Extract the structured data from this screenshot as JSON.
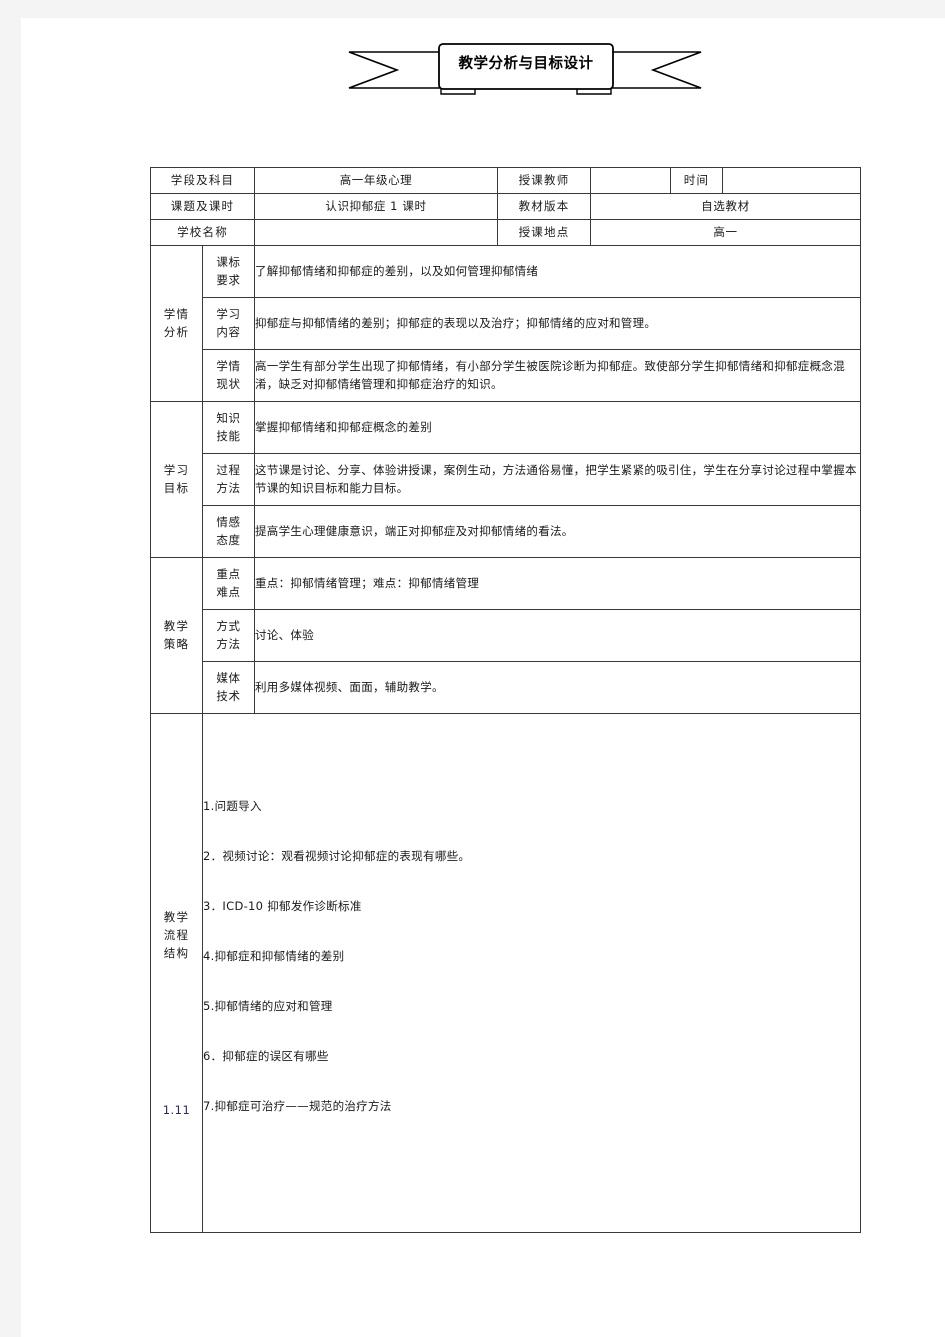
{
  "banner": {
    "title": "教学分析与目标设计"
  },
  "info_rows": [
    {
      "label": "学段及科目",
      "value": "高一年级心理",
      "label2": "授课教师",
      "value2": "",
      "label3": "时间",
      "value3": ""
    },
    {
      "label": "课题及课时",
      "value": "认识抑郁症 1 课时",
      "label2": "教材版本",
      "value2": "自选教材"
    },
    {
      "label": "学校名称",
      "value": "",
      "label2": "授课地点",
      "value2": "高一"
    }
  ],
  "sections": [
    {
      "title_lines": [
        "学情",
        "分析"
      ],
      "rows": [
        {
          "sub_lines": [
            "课标",
            "要求"
          ],
          "text": "了解抑郁情绪和抑郁症的差别，以及如何管理抑郁情绪"
        },
        {
          "sub_lines": [
            "学习",
            "内容"
          ],
          "text": "抑郁症与抑郁情绪的差别；抑郁症的表现以及治疗；抑郁情绪的应对和管理。"
        },
        {
          "sub_lines": [
            "学情",
            "现状"
          ],
          "text": "高一学生有部分学生出现了抑郁情绪，有小部分学生被医院诊断为抑郁症。致使部分学生抑郁情绪和抑郁症概念混淆，缺乏对抑郁情绪管理和抑郁症治疗的知识。"
        }
      ]
    },
    {
      "title_lines": [
        "学习",
        "目标"
      ],
      "rows": [
        {
          "sub_lines": [
            "知识",
            "技能"
          ],
          "text": "掌握抑郁情绪和抑郁症概念的差别"
        },
        {
          "sub_lines": [
            "过程",
            "方法"
          ],
          "text": "这节课是讨论、分享、体验讲授课，案例生动，方法通俗易懂，把学生紧紧的吸引住，学生在分享讨论过程中掌握本节课的知识目标和能力目标。"
        },
        {
          "sub_lines": [
            "情感",
            "态度"
          ],
          "text": "提高学生心理健康意识，端正对抑郁症及对抑郁情绪的看法。"
        }
      ]
    },
    {
      "title_lines": [
        "教学",
        "策略"
      ],
      "rows": [
        {
          "sub_lines": [
            "重点",
            "难点"
          ],
          "text": "重点：抑郁情绪管理；难点：抑郁情绪管理"
        },
        {
          "sub_lines": [
            "方式",
            "方法"
          ],
          "text": "讨论、体验"
        },
        {
          "sub_lines": [
            "媒体",
            "技术"
          ],
          "text": "利用多媒体视频、面面，辅助教学。"
        }
      ]
    }
  ],
  "flow": {
    "title_lines": [
      "教学",
      "流程",
      "结构"
    ],
    "footnote": "1.11",
    "steps": [
      "1.问题导入",
      "2．视频讨论：观看视频讨论抑郁症的表现有哪些。",
      "3．ICD-10 抑郁发作诊断标准",
      "4.抑郁症和抑郁情绪的差别",
      "5.抑郁情绪的应对和管理",
      "6．抑郁症的误区有哪些",
      "7.抑郁症可治疗——规范的治疗方法"
    ]
  }
}
